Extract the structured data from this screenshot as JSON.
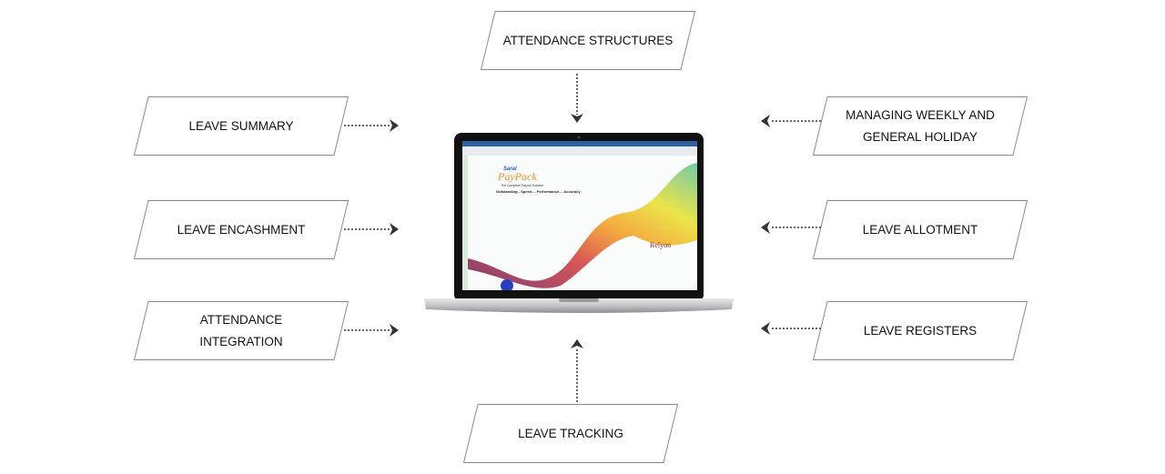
{
  "features": {
    "top": "ATTENDANCE STRUCTURES",
    "left": [
      "LEAVE SUMMARY",
      "LEAVE ENCASHMENT",
      "ATTENDANCE INTEGRATION"
    ],
    "right": [
      "MANAGING WEEKLY AND GENERAL HOLIDAY",
      "LEAVE ALLOTMENT",
      "LEAVE REGISTERS"
    ],
    "bottom": "LEAVE TRACKING"
  },
  "screen": {
    "title_small": "Saral",
    "title": "PayPack",
    "tagline": "The Complete Payroll Solution",
    "slogan": "Outstanding - Speed.... Performance.... Accuracy",
    "brand": "Relyon"
  },
  "colors": {
    "border": "#8a8a8a",
    "arrow": "#333333",
    "paypack": "#e8901a",
    "saral": "#2a5db0"
  }
}
